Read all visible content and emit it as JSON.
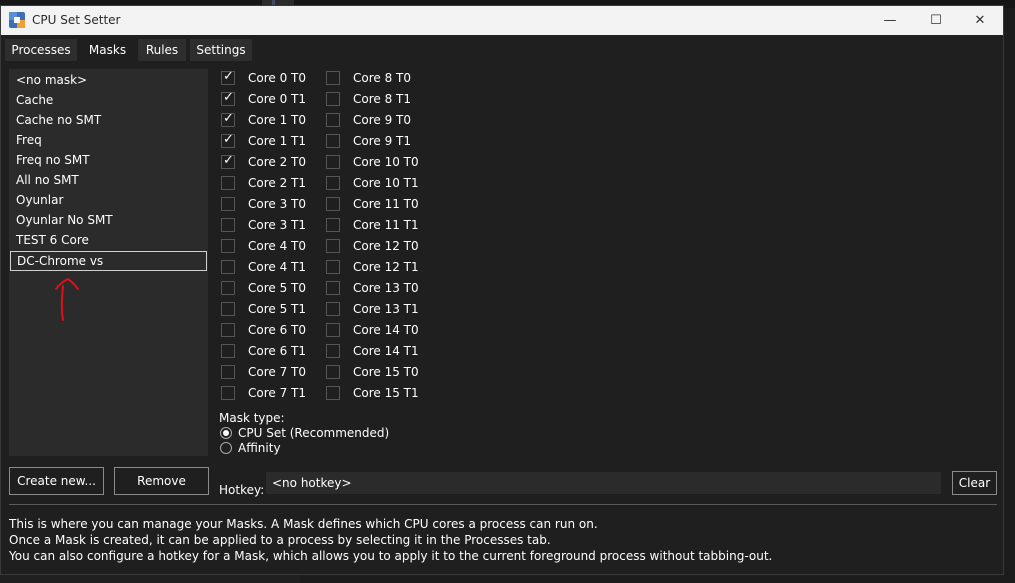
{
  "window": {
    "title": "CPU Set Setter",
    "controls": {
      "minimize": "—",
      "maximize": "☐",
      "close": "✕"
    }
  },
  "tabs": [
    {
      "label": "Processes",
      "active": false
    },
    {
      "label": "Masks",
      "active": true
    },
    {
      "label": "Rules",
      "active": false
    },
    {
      "label": "Settings",
      "active": false
    }
  ],
  "masks": [
    "<no mask>",
    "Cache",
    "Cache no SMT",
    "Freq",
    "Freq no SMT",
    "All no SMT",
    "Oyunlar",
    "Oyunlar No SMT",
    "TEST 6 Core",
    "DC-Chrome vs"
  ],
  "selected_mask_index": 9,
  "cores_left": [
    {
      "label": "Core 0 T0",
      "checked": true
    },
    {
      "label": "Core 0 T1",
      "checked": true
    },
    {
      "label": "Core 1 T0",
      "checked": true
    },
    {
      "label": "Core 1 T1",
      "checked": true
    },
    {
      "label": "Core 2 T0",
      "checked": true
    },
    {
      "label": "Core 2 T1",
      "checked": false
    },
    {
      "label": "Core 3 T0",
      "checked": false
    },
    {
      "label": "Core 3 T1",
      "checked": false
    },
    {
      "label": "Core 4 T0",
      "checked": false
    },
    {
      "label": "Core 4 T1",
      "checked": false
    },
    {
      "label": "Core 5 T0",
      "checked": false
    },
    {
      "label": "Core 5 T1",
      "checked": false
    },
    {
      "label": "Core 6 T0",
      "checked": false
    },
    {
      "label": "Core 6 T1",
      "checked": false
    },
    {
      "label": "Core 7 T0",
      "checked": false
    },
    {
      "label": "Core 7 T1",
      "checked": false
    }
  ],
  "cores_right": [
    {
      "label": "Core 8 T0",
      "checked": false
    },
    {
      "label": "Core 8 T1",
      "checked": false
    },
    {
      "label": "Core 9 T0",
      "checked": false
    },
    {
      "label": "Core 9 T1",
      "checked": false
    },
    {
      "label": "Core 10 T0",
      "checked": false
    },
    {
      "label": "Core 10 T1",
      "checked": false
    },
    {
      "label": "Core 11 T0",
      "checked": false
    },
    {
      "label": "Core 11 T1",
      "checked": false
    },
    {
      "label": "Core 12 T0",
      "checked": false
    },
    {
      "label": "Core 12 T1",
      "checked": false
    },
    {
      "label": "Core 13 T0",
      "checked": false
    },
    {
      "label": "Core 13 T1",
      "checked": false
    },
    {
      "label": "Core 14 T0",
      "checked": false
    },
    {
      "label": "Core 14 T1",
      "checked": false
    },
    {
      "label": "Core 15 T0",
      "checked": false
    },
    {
      "label": "Core 15 T1",
      "checked": false
    }
  ],
  "mask_type": {
    "label": "Mask type:",
    "options": [
      {
        "label": "CPU Set (Recommended)",
        "selected": true
      },
      {
        "label": "Affinity",
        "selected": false
      }
    ]
  },
  "buttons": {
    "create": "Create new...",
    "remove": "Remove",
    "clear": "Clear"
  },
  "hotkey": {
    "label": "Hotkey:",
    "value": "<no hotkey>"
  },
  "help_lines": [
    "This is where you can manage your Masks. A Mask defines which CPU cores a process can run on.",
    "Once a Mask is created, it can be applied to a process by selecting it in the Processes tab.",
    "You can also configure a hotkey for a Mask, which allows you to apply it to the current foreground process without tabbing-out."
  ],
  "annotation_color": "#e0101a"
}
